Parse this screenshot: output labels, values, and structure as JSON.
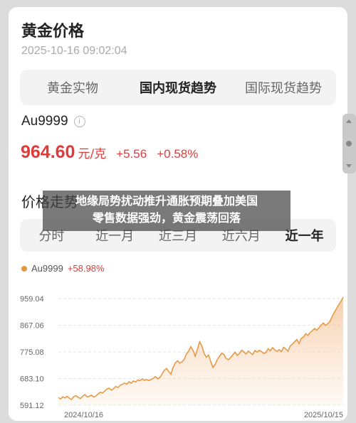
{
  "header": {
    "title": "黄金价格",
    "timestamp": "2025-10-16 09:02:04"
  },
  "segments": [
    {
      "label": "黄金实物",
      "active": false
    },
    {
      "label": "国内现货趋势",
      "active": true
    },
    {
      "label": "国际现货趋势",
      "active": false
    }
  ],
  "quote": {
    "symbol": "Au9999",
    "price": "964.60",
    "unit": "元/克",
    "change": "+5.56",
    "change_pct": "+0.58%",
    "color": "#e03b3b"
  },
  "trend": {
    "title": "价格走势",
    "tabs": [
      {
        "label": "分时",
        "active": false
      },
      {
        "label": "近一月",
        "active": false
      },
      {
        "label": "近三月",
        "active": false
      },
      {
        "label": "近六月",
        "active": false
      },
      {
        "label": "近一年",
        "active": true
      }
    ]
  },
  "overlay": {
    "line1": "地缘局势扰动推升通胀预期叠加美国",
    "line2": "零售数据强劲，黄金震荡回落"
  },
  "chart_data": {
    "type": "area",
    "legend": {
      "name": "Au9999",
      "change": "+58.98%",
      "color": "#e8953b"
    },
    "yticks": [
      "959.04",
      "867.06",
      "775.08",
      "683.10",
      "591.12"
    ],
    "ylim": [
      591.12,
      959.04
    ],
    "xlabels": [
      "2024/10/16",
      "2025/10/15"
    ],
    "grid": true,
    "values": [
      617,
      613,
      620,
      616,
      622,
      615,
      611,
      621,
      624,
      618,
      614,
      622,
      628,
      620,
      622,
      626,
      619,
      623,
      630,
      636,
      633,
      640,
      647,
      650,
      643,
      648,
      656,
      652,
      660,
      663,
      668,
      664,
      672,
      667,
      675,
      671,
      678,
      676,
      682,
      677,
      680,
      676,
      680,
      684,
      690,
      682,
      687,
      699,
      712,
      718,
      707,
      698,
      722,
      737,
      745,
      736,
      741,
      749,
      768,
      778,
      793,
      781,
      760,
      785,
      810,
      795,
      770,
      757,
      764,
      742,
      721,
      732,
      749,
      760,
      771,
      766,
      752,
      748,
      756,
      765,
      774,
      763,
      770,
      781,
      775,
      768,
      778,
      772,
      766,
      780,
      774,
      781,
      776,
      770,
      773,
      786,
      779,
      790,
      782,
      777,
      783,
      776,
      791,
      785,
      778,
      796,
      802,
      810,
      818,
      804,
      822,
      826,
      838,
      832,
      842,
      848,
      856,
      850,
      858,
      868,
      875,
      866,
      872,
      880,
      898,
      912,
      925,
      938,
      950,
      964
    ]
  }
}
